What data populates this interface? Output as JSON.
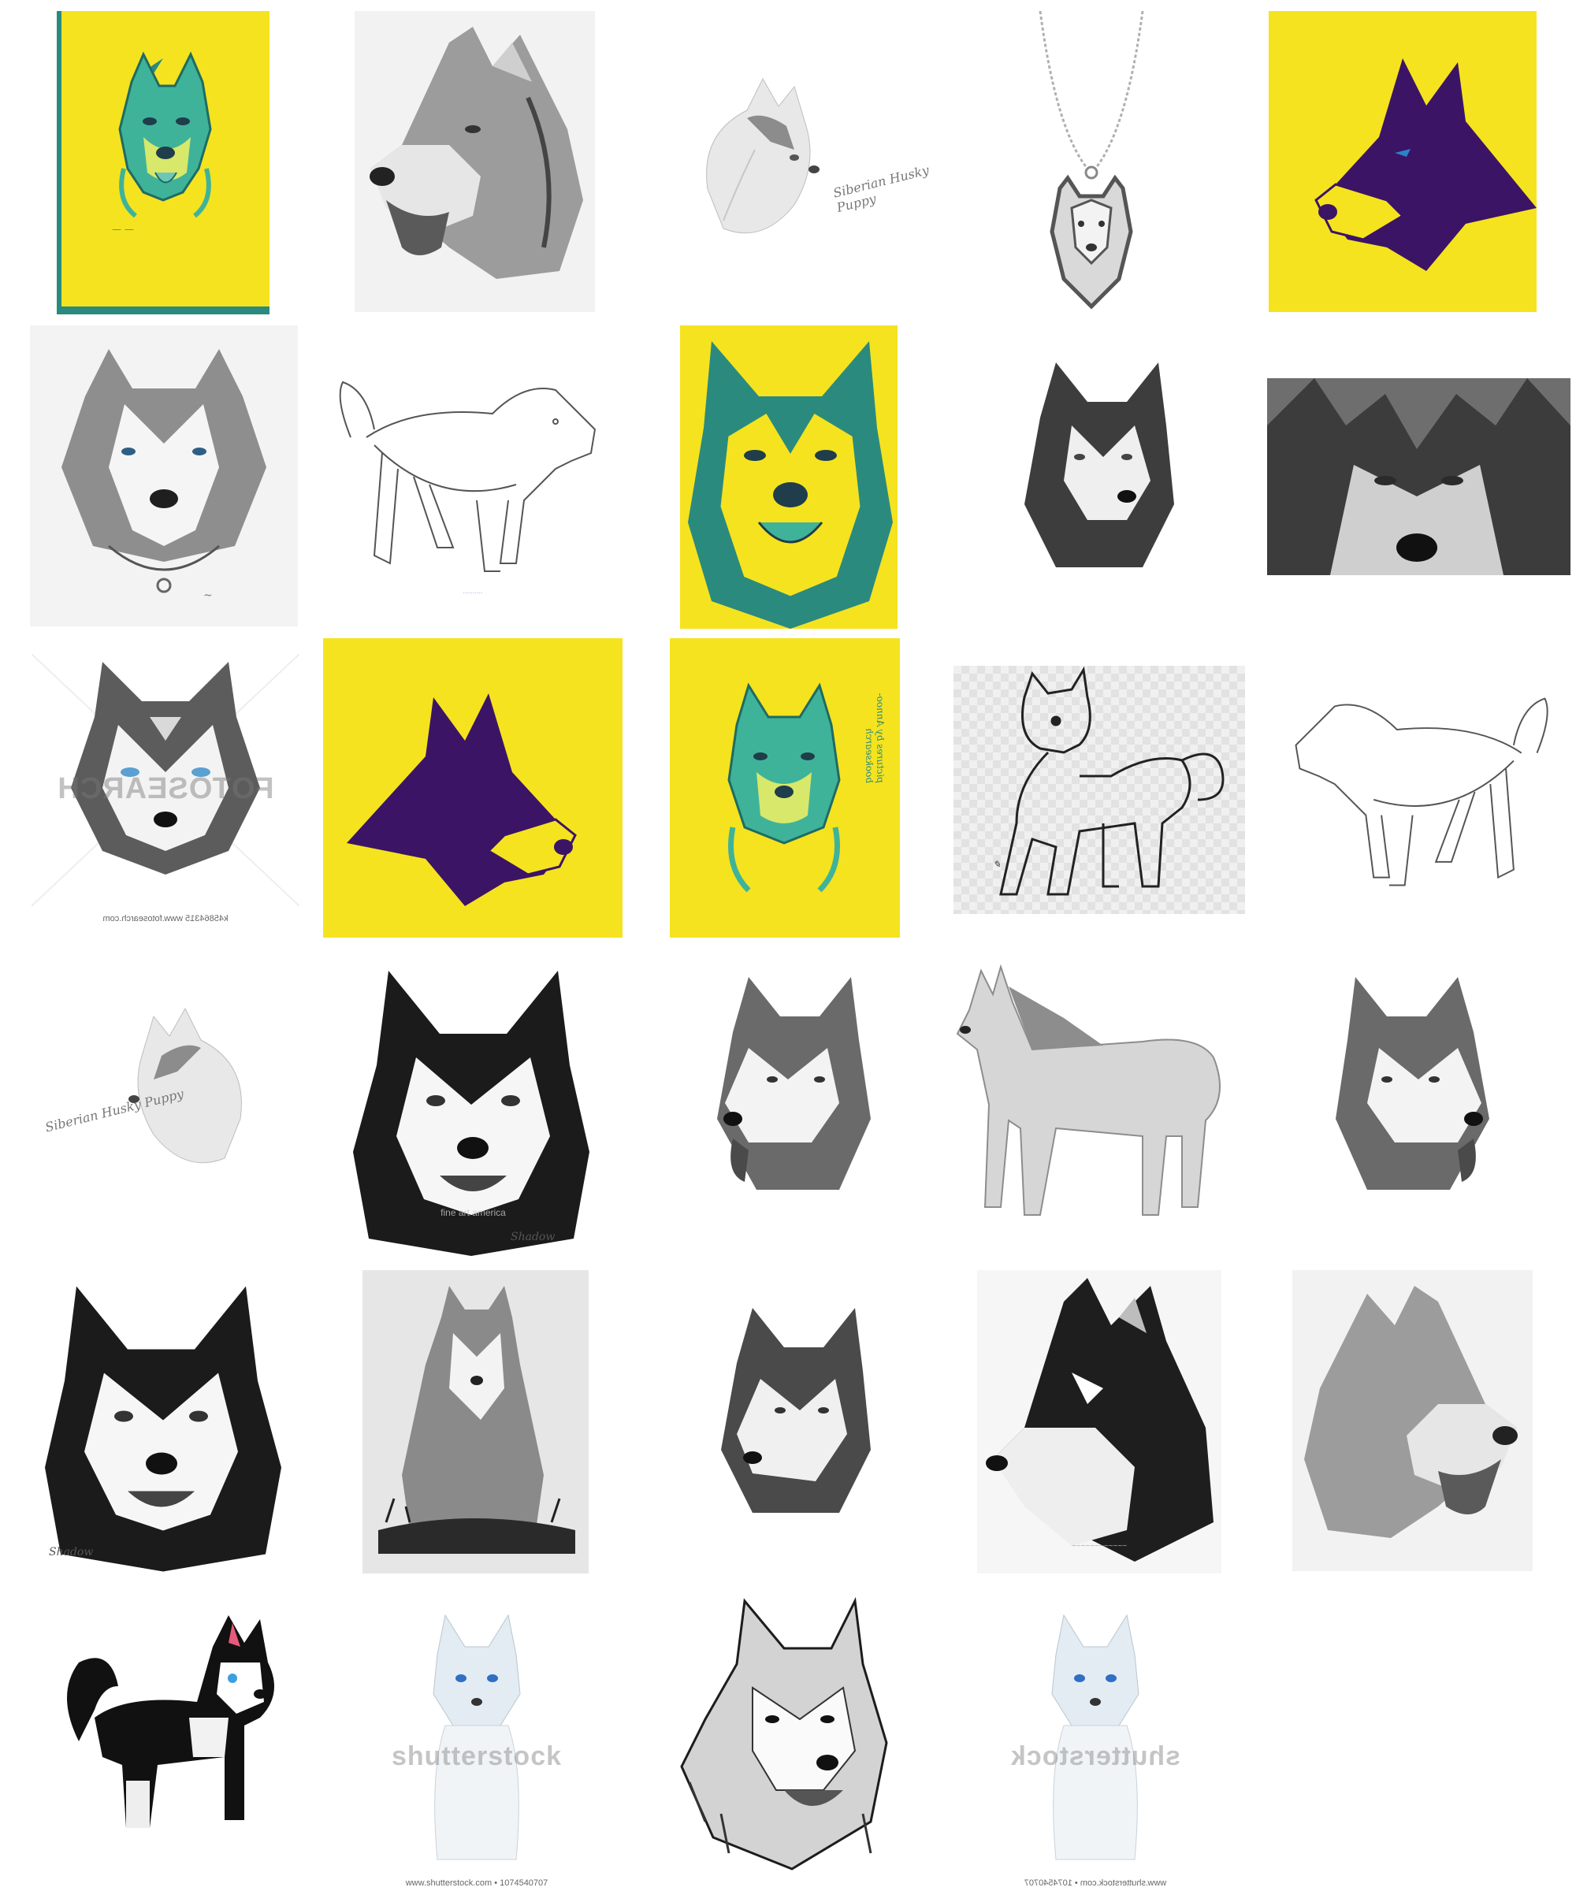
{
  "grid": {
    "rows": [
      {
        "tiles": [
          {
            "name": "yellow-teal-husky-portrait",
            "style": "yellow-teal"
          },
          {
            "name": "pencil-husky-profile-tongue",
            "style": "pencil"
          },
          {
            "name": "sketch-husky-puppy",
            "style": "light-sketch"
          },
          {
            "name": "husky-pendant-necklace",
            "style": "pendant"
          },
          {
            "name": "yellow-purple-husky-silhouette",
            "style": "yellow-purple"
          }
        ]
      },
      {
        "tiles": [
          {
            "name": "pencil-husky-front-collar",
            "style": "pencil"
          },
          {
            "name": "lineart-husky-walking",
            "style": "lineart"
          },
          {
            "name": "yellow-teal-husky-face",
            "style": "yellow-teal"
          },
          {
            "name": "pencil-husky-three-quarter",
            "style": "pencil"
          },
          {
            "name": "gray-husky-closeup",
            "style": "photo-gray"
          }
        ]
      },
      {
        "tiles": [
          {
            "name": "vector-husky-head",
            "style": "vector"
          },
          {
            "name": "yellow-purple-husky-silhouette-mirrored",
            "style": "yellow-purple"
          },
          {
            "name": "yellow-teal-husky-portrait-mirrored",
            "style": "yellow-teal"
          },
          {
            "name": "lineart-husky-puppy-checker",
            "style": "lineart"
          },
          {
            "name": "lineart-husky-walking-mirrored",
            "style": "lineart"
          }
        ]
      },
      {
        "tiles": [
          {
            "name": "sketch-husky-puppy-mirrored",
            "style": "light-sketch"
          },
          {
            "name": "charcoal-husky-front",
            "style": "charcoal"
          },
          {
            "name": "pencil-husky-three-quarter-tongue",
            "style": "pencil"
          },
          {
            "name": "pencil-husky-standing",
            "style": "pencil"
          },
          {
            "name": "pencil-husky-three-quarter-tongue-mirrored",
            "style": "pencil"
          }
        ]
      },
      {
        "tiles": [
          {
            "name": "charcoal-husky-front-mirrored",
            "style": "charcoal"
          },
          {
            "name": "pencil-husky-sitting-grass",
            "style": "pencil"
          },
          {
            "name": "pencil-husky-head-down",
            "style": "pencil"
          },
          {
            "name": "pencil-husky-profile-dark",
            "style": "pencil"
          },
          {
            "name": "pencil-husky-profile-tongue-mirrored",
            "style": "pencil"
          }
        ]
      },
      {
        "tiles": [
          {
            "name": "cartoon-husky-standing",
            "style": "cartoon"
          },
          {
            "name": "watercolor-husky-puppy",
            "style": "watercolor"
          },
          {
            "name": "ink-husky-portrait",
            "style": "ink"
          },
          {
            "name": "watercolor-husky-puppy-mirrored",
            "style": "watercolor"
          }
        ]
      }
    ]
  },
  "watermarks": {
    "fotosearch": "FOTOSEARCH",
    "fotosearch_caption": "k45864315  www.fotosearch.com",
    "shutterstock": "shutterstock",
    "shutterstock_caption": "www.shutterstock.com • 1074540707",
    "fineart_caption": "fine art america",
    "puppy_signature": "Siberian Husky Puppy",
    "shadow_signature": "Shadow",
    "pictures_by": "pictures by Annoo-booksearch"
  },
  "colors": {
    "yellow": "#f5e31f",
    "teal": "#2b8a7e",
    "purple": "#3b1466",
    "pencil_dark": "#2a2a2a",
    "pencil_mid": "#8a8a8a",
    "pencil_light": "#d0d0d0"
  }
}
